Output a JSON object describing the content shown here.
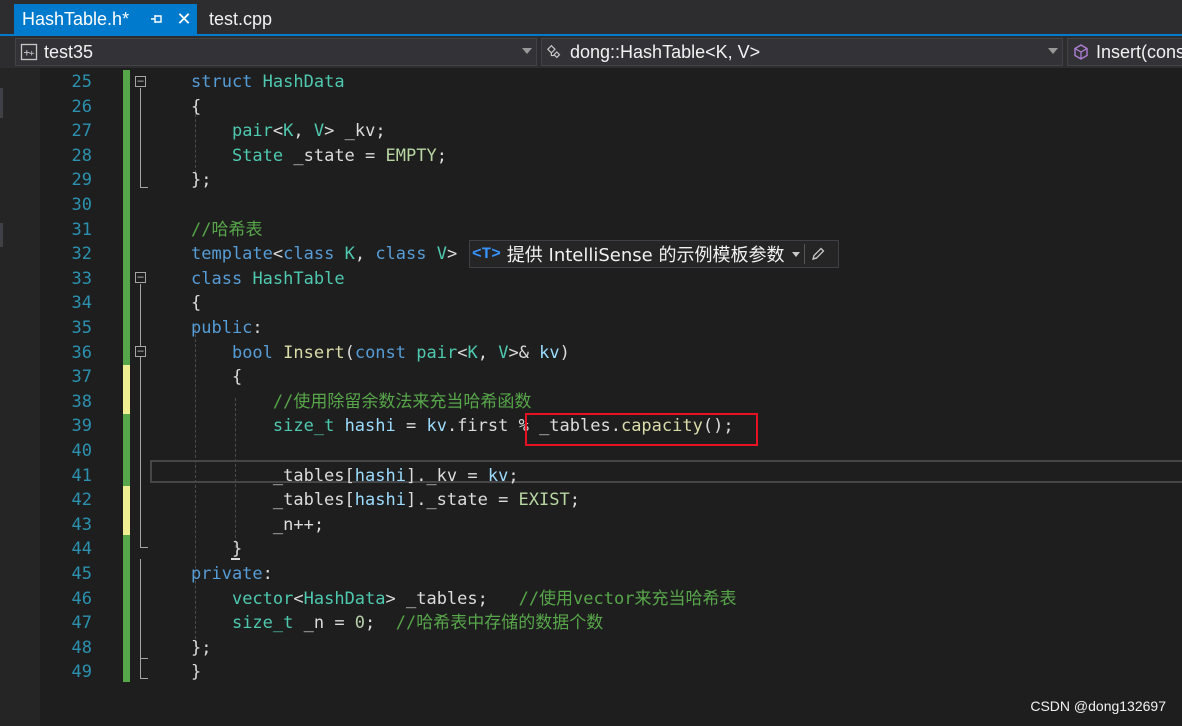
{
  "tabs": [
    {
      "label": "HashTable.h*",
      "active": true
    },
    {
      "label": "test.cpp",
      "active": false
    }
  ],
  "navigation": {
    "project": "test35",
    "scope": "dong::HashTable<K, V>",
    "member": "Insert(const pair<K, V>& kv)"
  },
  "editor": {
    "line_numbers": [
      "25",
      "26",
      "27",
      "28",
      "29",
      "30",
      "31",
      "32",
      "33",
      "34",
      "35",
      "36",
      "37",
      "38",
      "39",
      "40",
      "41",
      "42",
      "43",
      "44",
      "45",
      "46",
      "47",
      "48",
      "49"
    ],
    "intellisense_hint": {
      "badge": "<T>",
      "text": "提供 IntelliSense 的示例模板参数"
    }
  },
  "watermark": "CSDN @dong132697",
  "colors": {
    "accent": "#007acc",
    "background": "#1e1e1e",
    "line_number": "#2b91af",
    "keyword": "#569cd6",
    "type": "#4ec9b0",
    "comment": "#57a64a",
    "highlight_box": "#e81123"
  }
}
